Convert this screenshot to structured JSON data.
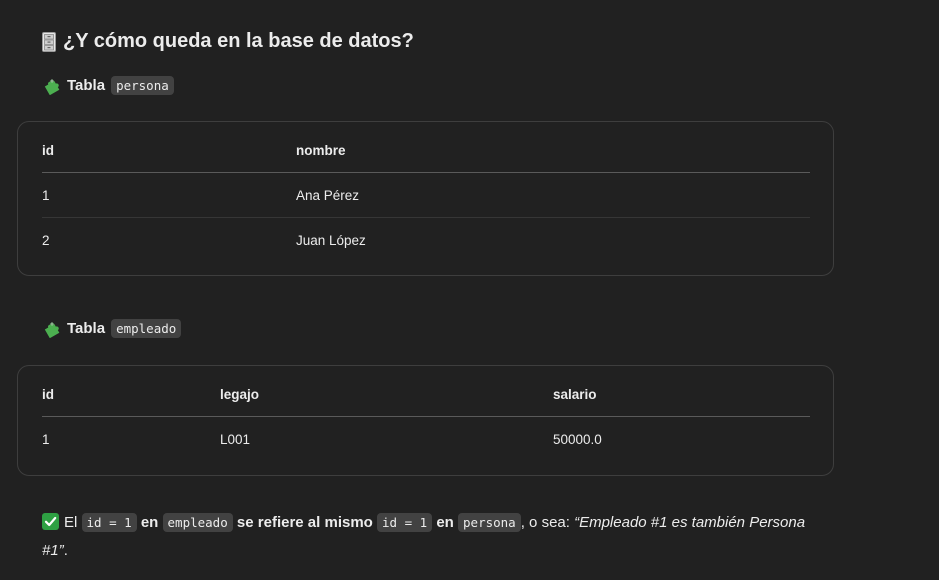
{
  "heading": {
    "icon": "file-cabinet-icon",
    "text": "¿Y cómo queda en la base de datos?"
  },
  "table_persona": {
    "icon": "puzzle-piece-icon",
    "title_prefix": "Tabla",
    "title_code": "persona",
    "columns": [
      "id",
      "nombre"
    ],
    "rows": [
      [
        "1",
        "Ana Pérez"
      ],
      [
        "2",
        "Juan López"
      ]
    ]
  },
  "table_empleado": {
    "icon": "puzzle-piece-icon",
    "title_prefix": "Tabla",
    "title_code": "empleado",
    "columns": [
      "id",
      "legajo",
      "salario"
    ],
    "rows": [
      [
        "1",
        "L001",
        "50000.0"
      ]
    ]
  },
  "summary": {
    "icon": "check-mark-icon",
    "part1": "El",
    "code1": "id = 1",
    "part2": "en",
    "code2": "empleado",
    "part3": "se refiere al mismo",
    "code3": "id = 1",
    "part4": "en",
    "code4": "persona",
    "part5": ", o sea:",
    "quote": "“Empleado #1 es también Persona #1”",
    "end": "."
  },
  "colors": {
    "background": "#212121",
    "text": "#ececec",
    "code_background": "#424242",
    "border": "#3e3e3e",
    "check_green": "#2ea043",
    "puzzle_green": "#4caf50"
  }
}
